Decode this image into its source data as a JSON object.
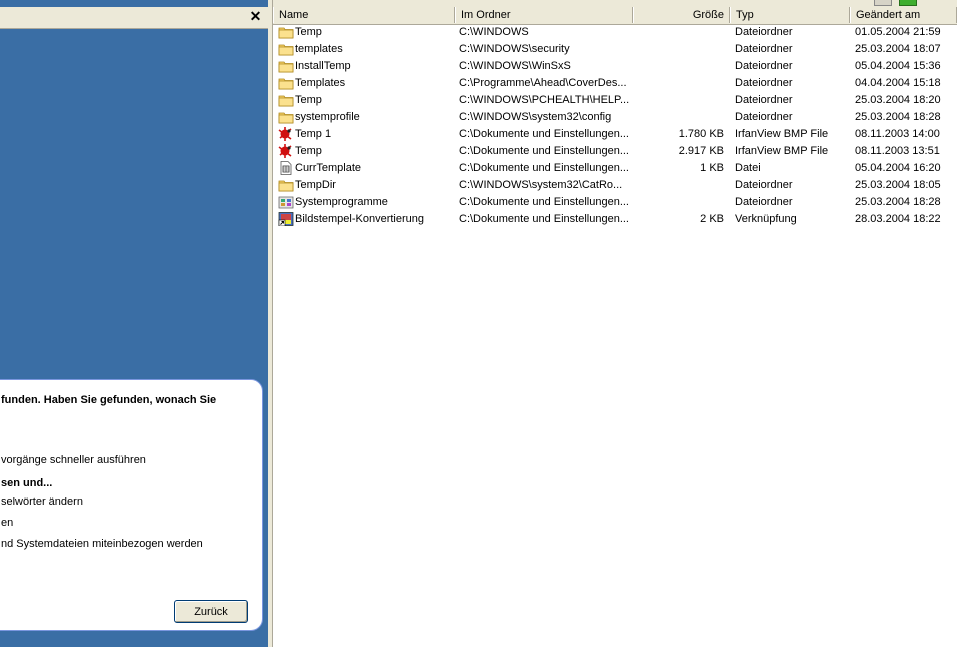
{
  "search_pane": {
    "close_glyph": "✕",
    "assistant": {
      "heading_line1": "funden. Haben Sie gefunden, wonach Sie",
      "option_faster": "vorgänge schneller ausführen",
      "subheading": "sen und...",
      "option_keywords": "selwörter ändern",
      "option_en": "en",
      "option_system_files": "nd Systemdateien miteinbezogen werden",
      "back_button": "Zurück"
    }
  },
  "results": {
    "columns": {
      "name": "Name",
      "folder": "Im Ordner",
      "size": "Größe",
      "type": "Typ",
      "modified": "Geändert am"
    },
    "rows": [
      {
        "icon": "folder-icon",
        "name": "Temp",
        "folder": "C:\\WINDOWS",
        "size": "",
        "type": "Dateiordner",
        "modified": "01.05.2004 21:59"
      },
      {
        "icon": "folder-icon",
        "name": "templates",
        "folder": "C:\\WINDOWS\\security",
        "size": "",
        "type": "Dateiordner",
        "modified": "25.03.2004 18:07"
      },
      {
        "icon": "folder-icon",
        "name": "InstallTemp",
        "folder": "C:\\WINDOWS\\WinSxS",
        "size": "",
        "type": "Dateiordner",
        "modified": "05.04.2004 15:36"
      },
      {
        "icon": "folder-icon",
        "name": "Templates",
        "folder": "C:\\Programme\\Ahead\\CoverDes...",
        "size": "",
        "type": "Dateiordner",
        "modified": "04.04.2004 15:18"
      },
      {
        "icon": "folder-icon",
        "name": "Temp",
        "folder": "C:\\WINDOWS\\PCHEALTH\\HELP...",
        "size": "",
        "type": "Dateiordner",
        "modified": "25.03.2004 18:20"
      },
      {
        "icon": "folder-icon",
        "name": "systemprofile",
        "folder": "C:\\WINDOWS\\system32\\config",
        "size": "",
        "type": "Dateiordner",
        "modified": "25.03.2004 18:28"
      },
      {
        "icon": "irfanview-bmp-icon",
        "name": "Temp 1",
        "folder": "C:\\Dokumente und Einstellungen...",
        "size": "1.780 KB",
        "type": "IrfanView BMP File",
        "modified": "08.11.2003 14:00"
      },
      {
        "icon": "irfanview-bmp-icon",
        "name": "Temp",
        "folder": "C:\\Dokumente und Einstellungen...",
        "size": "2.917 KB",
        "type": "IrfanView BMP File",
        "modified": "08.11.2003 13:51"
      },
      {
        "icon": "generic-file-icon",
        "name": "CurrTemplate",
        "folder": "C:\\Dokumente und Einstellungen...",
        "size": "1 KB",
        "type": "Datei",
        "modified": "05.04.2004 16:20"
      },
      {
        "icon": "folder-icon",
        "name": "TempDir",
        "folder": "C:\\WINDOWS\\system32\\CatRo...",
        "size": "",
        "type": "Dateiordner",
        "modified": "25.03.2004 18:05"
      },
      {
        "icon": "program-folder-icon",
        "name": "Systemprogramme",
        "folder": "C:\\Dokumente und Einstellungen...",
        "size": "",
        "type": "Dateiordner",
        "modified": "25.03.2004 18:28"
      },
      {
        "icon": "shortcut-icon",
        "name": "Bildstempel-Konvertierung",
        "folder": "C:\\Dokumente und Einstellungen...",
        "size": "2 KB",
        "type": "Verknüpfung",
        "modified": "28.03.2004 18:22"
      }
    ]
  }
}
